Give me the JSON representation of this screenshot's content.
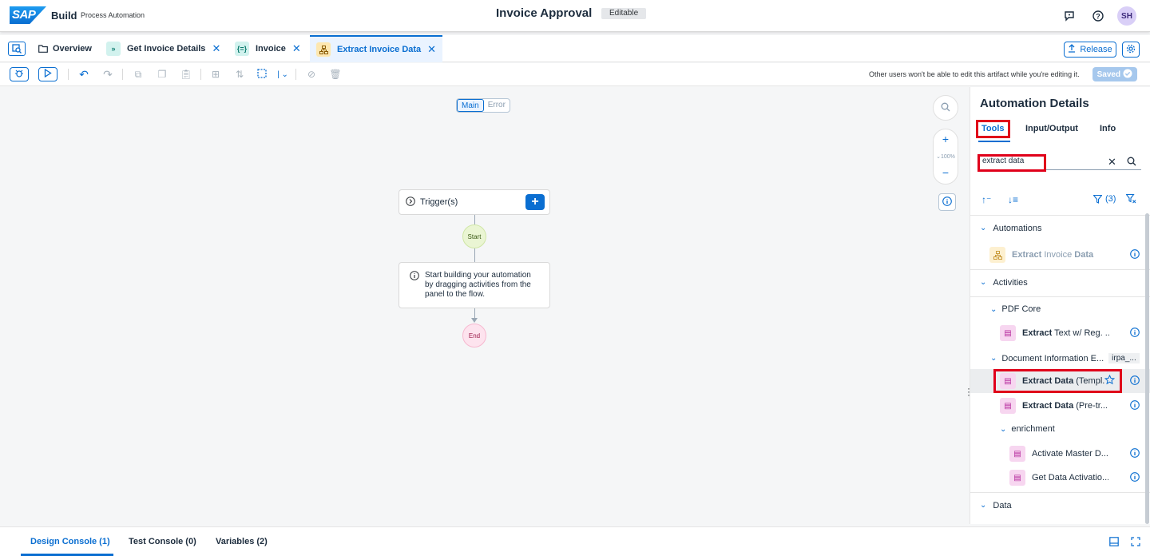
{
  "shell": {
    "logo": "SAP",
    "product": "Build",
    "subtitle": "Process Automation",
    "title": "Invoice Approval",
    "badge": "Editable",
    "avatar_initials": "SH"
  },
  "tabs": [
    {
      "label": "Overview",
      "icon": "folder-icon"
    },
    {
      "label": "Get Invoice Details",
      "icon": "data-flow-icon"
    },
    {
      "label": "Invoice",
      "icon": "data-type-icon"
    },
    {
      "label": "Extract Invoice Data",
      "icon": "automation-icon",
      "active": true
    }
  ],
  "header_actions": {
    "release_label": "Release"
  },
  "toolbar": {
    "note": "Other users won't be able to edit this artifact while you're editing it.",
    "saved_label": "Saved"
  },
  "canvas": {
    "mode_main": "Main",
    "mode_error": "Error",
    "trigger_label": "Trigger(s)",
    "start_label": "Start",
    "end_label": "End",
    "hint": "Start building your automation by dragging activities from the panel to the flow.",
    "zoom_label": "100%"
  },
  "panel": {
    "title": "Automation Details",
    "tabs": [
      "Tools",
      "Input/Output",
      "Info"
    ],
    "search_value": "extract data",
    "filter_label": "(3)",
    "sections": {
      "automations": "Automations",
      "activities": "Activities",
      "data": "Data"
    },
    "automation_item": {
      "bold": "Extract",
      "mid": " Invoice ",
      "bold2": "Data"
    },
    "groups": {
      "pdf_core": "PDF Core",
      "doc_info": "Document Information E...",
      "doc_info_badge": "irpa_...",
      "enrichment": "enrichment"
    },
    "items": [
      {
        "bold": "Extract",
        "rest": " Text w/ Reg. ..."
      },
      {
        "bold": "Extract Data",
        "rest": " (Templ..."
      },
      {
        "bold": "Extract Data",
        "rest": " (Pre-tr..."
      },
      {
        "bold": "",
        "rest": "Activate Master D..."
      },
      {
        "bold": "",
        "rest": "Get Data Activatio..."
      }
    ]
  },
  "bottom": {
    "tabs": [
      "Design Console (1)",
      "Test Console (0)",
      "Variables (2)"
    ]
  },
  "colors": {
    "accent": "#0a6ed1",
    "highlight": "#e0001a"
  }
}
